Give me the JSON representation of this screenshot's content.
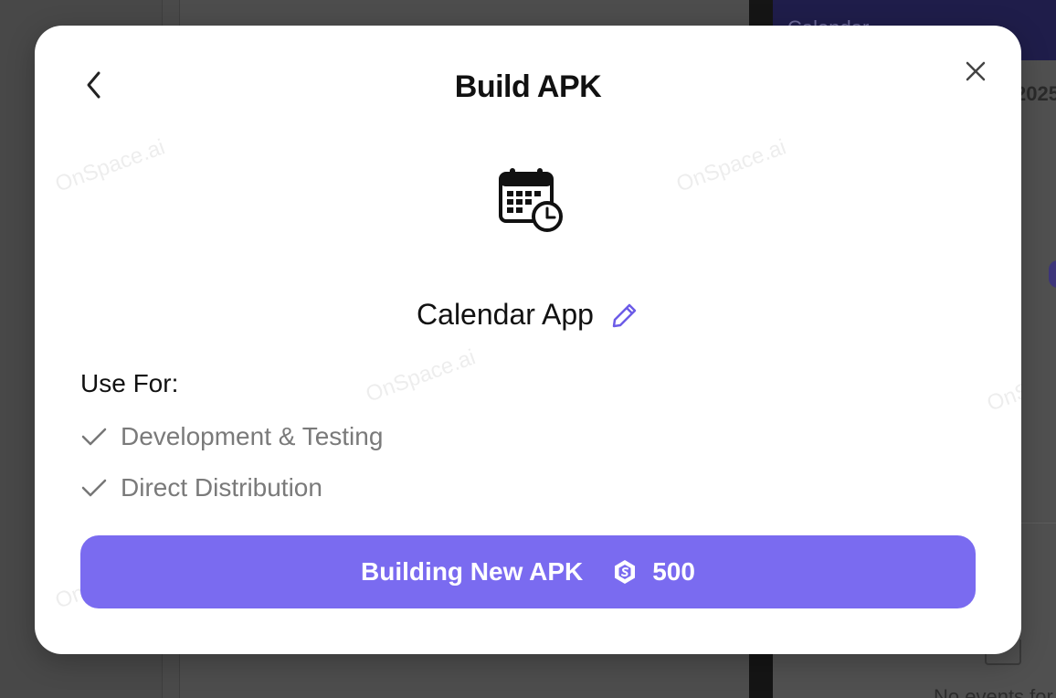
{
  "background": {
    "right_app": {
      "header_title": "Calendar",
      "year_fragment": "2025",
      "footer_fragment": "No events for this"
    }
  },
  "watermark": {
    "text": "OnSpace.ai"
  },
  "modal": {
    "title": "Build APK",
    "app_name": "Calendar App",
    "use_for_label": "Use For:",
    "features": [
      "Development & Testing",
      "Direct Distribution"
    ],
    "build_button": {
      "label": "Building New APK",
      "credits": "500"
    }
  },
  "colors": {
    "accent": "#7a6bf0",
    "edit_icon": "#6c5ce7",
    "muted_text": "#7a7a7a",
    "title_text": "#111111"
  },
  "icons": {
    "back": "chevron-left-icon",
    "close": "close-icon",
    "app": "calendar-clock-icon",
    "edit": "pencil-icon",
    "check": "check-icon",
    "coin": "coin-icon"
  }
}
